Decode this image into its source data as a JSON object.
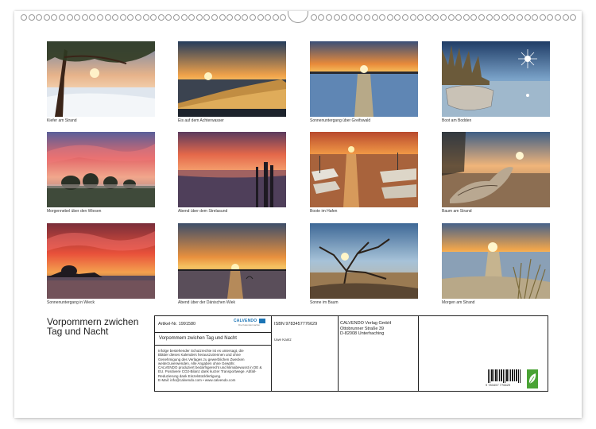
{
  "calendar": {
    "title": "Vorpommern zwichen Tag und Nacht",
    "photos": [
      {
        "caption": "Kiefer am Strand",
        "scene": "tree-winter-sunset"
      },
      {
        "caption": "Eis auf dem Achterwasser",
        "scene": "ice-sunset"
      },
      {
        "caption": "Sonnenuntergang über Greifswald",
        "scene": "sea-sunset-orange"
      },
      {
        "caption": "Boot am Bodden",
        "scene": "boat-reeds-sunstar"
      },
      {
        "caption": "Morgennebel über den Wiesen",
        "scene": "meadow-pink-sky"
      },
      {
        "caption": "Abend über dem Strelasund",
        "scene": "pier-red-sky"
      },
      {
        "caption": "Boote im Hafen",
        "scene": "harbor-boats"
      },
      {
        "caption": "Baum am Strand",
        "scene": "driftwood-beach"
      },
      {
        "caption": "Sonnenuntergang in Wieck",
        "scene": "village-red-clouds"
      },
      {
        "caption": "Abend über der Dänischen Wiek",
        "scene": "bay-sunset"
      },
      {
        "caption": "Sonne im Baum",
        "scene": "dead-tree-sun"
      },
      {
        "caption": "Morgen am Strand",
        "scene": "beach-grass-sunrise"
      }
    ]
  },
  "info_box": {
    "article": "Artikel-Nr. 1991580",
    "logo_text": "CALVENDO",
    "logo_sub": "Die Kalendermacher",
    "product_title": "Vorpommern zwichen Tag und Nacht",
    "isbn": "ISBN 9783457776629",
    "author": "Uwe Kantz",
    "publisher_lines": [
      "CALVENDO Verlag GmbH",
      "Ottobrunner Straße 39",
      "D-82008 Unterhaching"
    ],
    "legal_lines": [
      "Infolge bestehender Schutzrechte ist es untersagt, die",
      "Blätter dieses Kalenders herauszutrennen und ohne",
      "Genehmigung des Verlages zu gewerblichen Zwecken",
      "weiterzuverwenden. Alle Angaben ohne Gewähr.",
      "CALVENDO produziert bedarfsgerecht und klimabewusst in DE &",
      "EU. Positivere CO2-Bilanz dank kurzer Transportwege. Abfall-",
      "Reduzierung dank Einzelstückfertigung.",
      "E-Mail: info@calvendo.com • www.calvendo.com"
    ],
    "barcode_digits": "9 783457 776629"
  }
}
